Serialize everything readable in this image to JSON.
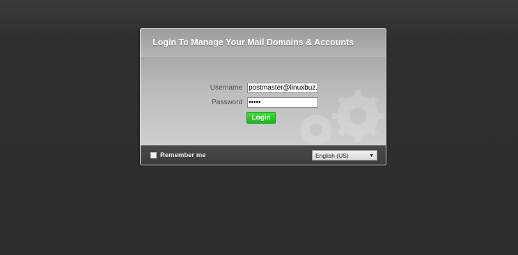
{
  "panel": {
    "title": "Login To Manage Your Mail Domains & Accounts"
  },
  "form": {
    "username_label": "Username",
    "username_value": "postmaster@linuxbuz.c",
    "password_label": "Password",
    "password_value": "•••••",
    "login_label": "Login"
  },
  "footer": {
    "remember_label": "Remember me",
    "remember_checked": false,
    "language_selected": "English (US)",
    "language_arrow": "▼"
  },
  "colors": {
    "page_background": "#2e2e2e",
    "login_button": "#22c022",
    "footer_background": "#404040"
  }
}
